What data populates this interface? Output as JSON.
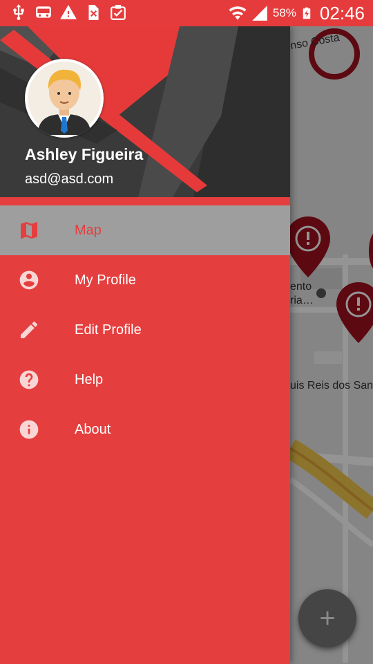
{
  "status_bar": {
    "battery": "58%",
    "time": "02:46",
    "icons": [
      "usb-icon",
      "bus-icon",
      "warning-icon",
      "no-sim-icon",
      "clipboard-check-icon",
      "wifi-icon",
      "signal-icon",
      "battery-charging-icon"
    ]
  },
  "drawer": {
    "user": {
      "name": "Ashley Figueira",
      "email": "asd@asd.com"
    },
    "items": [
      {
        "label": "Map",
        "icon": "map-icon",
        "selected": true
      },
      {
        "label": "My Profile",
        "icon": "account-circle-icon"
      },
      {
        "label": "Edit Profile",
        "icon": "pencil-icon"
      },
      {
        "label": "Help",
        "icon": "help-circle-icon"
      },
      {
        "label": "About",
        "icon": "info-icon"
      }
    ]
  },
  "map": {
    "labels": [
      "nso Costa",
      "ento",
      "ria…",
      "uis Reis dos Sant"
    ],
    "fab": "+"
  },
  "colors": {
    "accent": "#e53e3e",
    "selected_bg": "#9e9e9e",
    "header_dark": "#404040",
    "marker": "#a0101e"
  }
}
